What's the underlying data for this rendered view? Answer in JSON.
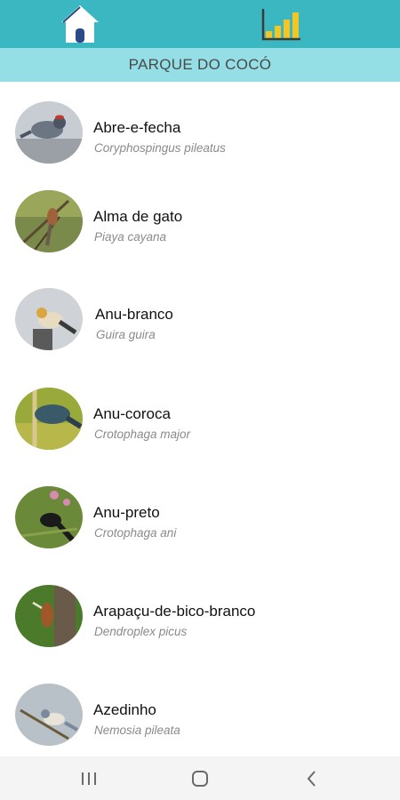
{
  "header": {
    "home_icon": "home-icon",
    "stats_icon": "bar-chart-icon",
    "title": "PARQUE DO COCÓ",
    "colors": {
      "topbar": "#3ab7c1",
      "titlebar": "#94dfe6"
    }
  },
  "birds": [
    {
      "name": "Abre-e-fecha",
      "scientific": "Coryphospingus pileatus"
    },
    {
      "name": "Alma de gato",
      "scientific": "Piaya cayana"
    },
    {
      "name": "Anu-branco",
      "scientific": "Guira guira"
    },
    {
      "name": "Anu-coroca",
      "scientific": "Crotophaga major"
    },
    {
      "name": "Anu-preto",
      "scientific": "Crotophaga ani"
    },
    {
      "name": "Arapaçu-de-bico-branco",
      "scientific": "Dendroplex picus"
    },
    {
      "name": "Azedinho",
      "scientific": "Nemosia pileata"
    }
  ],
  "system_nav": {
    "recents_icon": "recent-apps-icon",
    "home_icon": "system-home-icon",
    "back_icon": "back-icon"
  }
}
